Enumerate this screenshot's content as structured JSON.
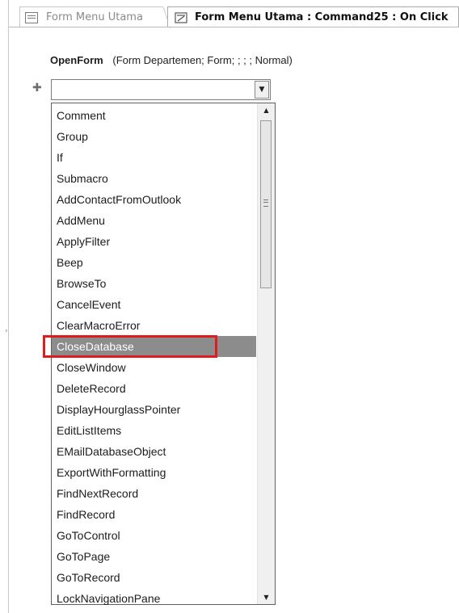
{
  "tabs": [
    {
      "label": "Form Menu Utama",
      "icon": "form-icon",
      "active": false
    },
    {
      "label": "Form Menu Utama : Command25 : On Click",
      "icon": "macro-icon",
      "active": true
    }
  ],
  "action": {
    "name": "OpenForm",
    "args": "(Form Departemen; Form; ; ; ; Normal)"
  },
  "combo": {
    "value": ""
  },
  "dropdown": {
    "selected": "CloseDatabase",
    "highlight_color": "#e01b1b",
    "items": [
      "Comment",
      "Group",
      "If",
      "Submacro",
      "AddContactFromOutlook",
      "AddMenu",
      "ApplyFilter",
      "Beep",
      "BrowseTo",
      "CancelEvent",
      "ClearMacroError",
      "CloseDatabase",
      "CloseWindow",
      "DeleteRecord",
      "DisplayHourglassPointer",
      "EditListItems",
      "EMailDatabaseObject",
      "ExportWithFormatting",
      "FindNextRecord",
      "FindRecord",
      "GoToControl",
      "GoToPage",
      "GoToRecord",
      "LockNavigationPane"
    ]
  }
}
